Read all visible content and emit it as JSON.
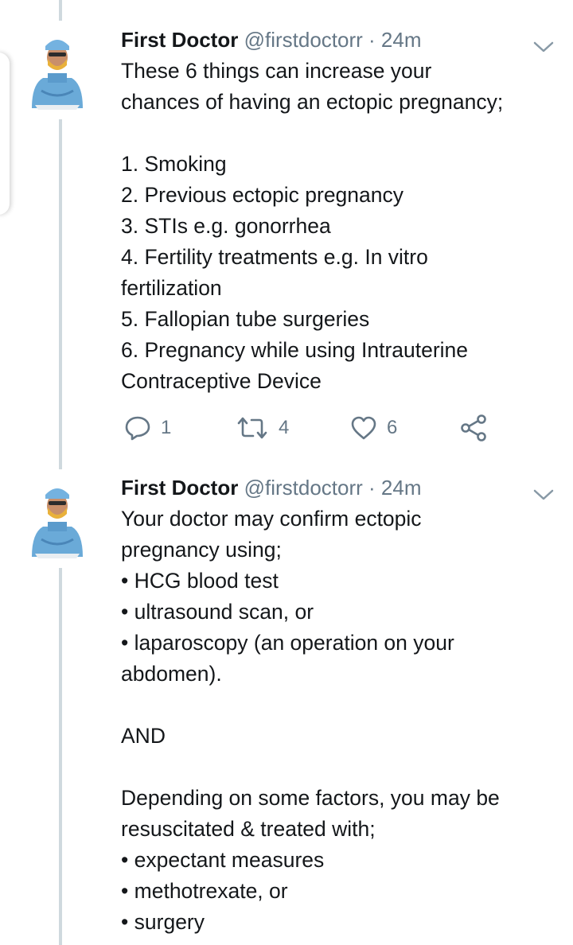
{
  "colors": {
    "text": "#14171a",
    "meta": "#657786",
    "thread_line": "#cfd9de",
    "icon": "#657786"
  },
  "tweets": [
    {
      "author_name": "First Doctor",
      "handle": "@firstdoctorr",
      "separator": "·",
      "time": "24m",
      "avatar_icon": "doctor-avatar",
      "menu_icon": "chevron-down-icon",
      "text": "These 6 things can increase your\nchances of having an ectopic pregnancy;\n\n1. Smoking\n2. Previous ectopic pregnancy\n3. STIs e.g. gonorrhea\n4. Fertility treatments e.g. In vitro\nfertilization\n5. Fallopian tube surgeries\n6. Pregnancy while using Intrauterine\nContraceptive Device",
      "actions": {
        "reply_count": "1",
        "retweet_count": "4",
        "like_count": "6",
        "reply_icon": "reply-icon",
        "retweet_icon": "retweet-icon",
        "like_icon": "heart-icon",
        "share_icon": "share-icon"
      }
    },
    {
      "author_name": "First Doctor",
      "handle": "@firstdoctorr",
      "separator": "·",
      "time": "24m",
      "avatar_icon": "doctor-avatar",
      "menu_icon": "chevron-down-icon",
      "text": "Your doctor may confirm ectopic\npregnancy using;\n• HCG blood test\n• ultrasound scan, or\n• laparoscopy (an operation on your\nabdomen).\n\nAND\n\nDepending on some factors, you may be\nresuscitated & treated with;\n• expectant measures\n• methotrexate, or\n• surgery"
    }
  ]
}
